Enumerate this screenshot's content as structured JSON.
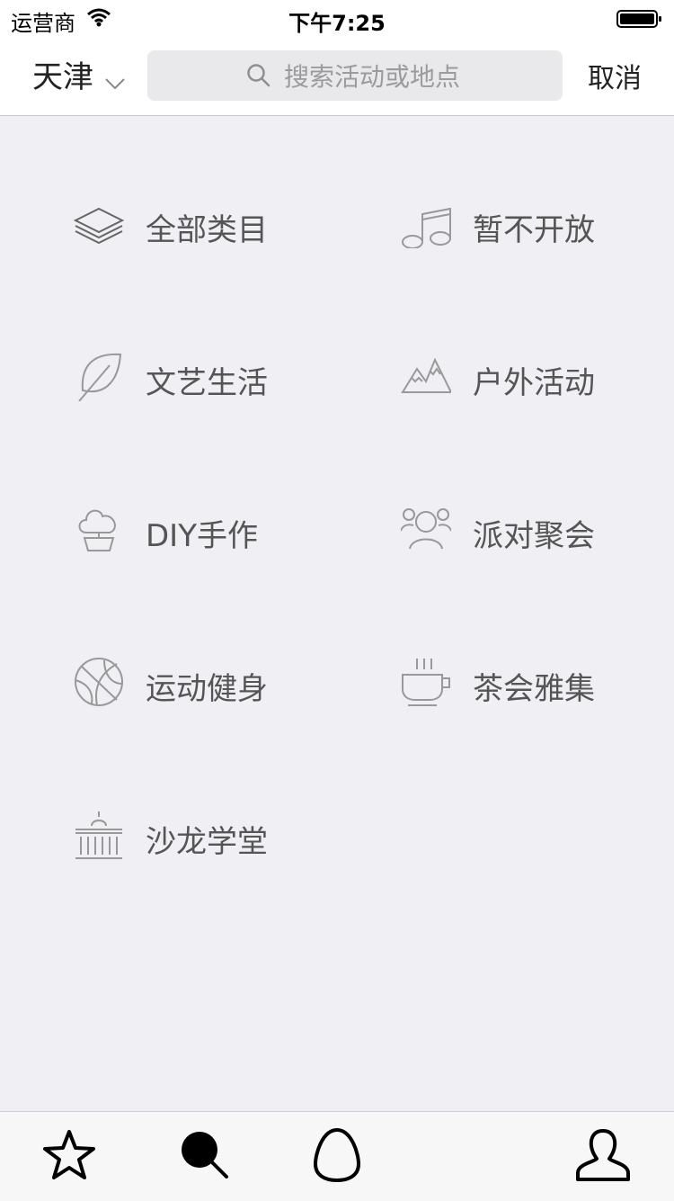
{
  "status_bar": {
    "carrier": "运营商",
    "time": "下午7:25"
  },
  "nav": {
    "city": "天津",
    "search_placeholder": "搜索活动或地点",
    "cancel_label": "取消"
  },
  "categories": [
    {
      "label": "全部类目",
      "icon": "layers-icon"
    },
    {
      "label": "暂不开放",
      "icon": "music-note-icon"
    },
    {
      "label": "文艺生活",
      "icon": "leaf-icon"
    },
    {
      "label": "户外活动",
      "icon": "mountain-icon"
    },
    {
      "label": "DIY手作",
      "icon": "plant-pot-icon"
    },
    {
      "label": "派对聚会",
      "icon": "party-people-icon"
    },
    {
      "label": "运动健身",
      "icon": "basketball-icon"
    },
    {
      "label": "茶会雅集",
      "icon": "tea-cup-icon"
    },
    {
      "label": "沙龙学堂",
      "icon": "hall-icon"
    }
  ],
  "tabbar": [
    "star-icon",
    "search-icon",
    "egg-icon",
    "user-icon"
  ]
}
